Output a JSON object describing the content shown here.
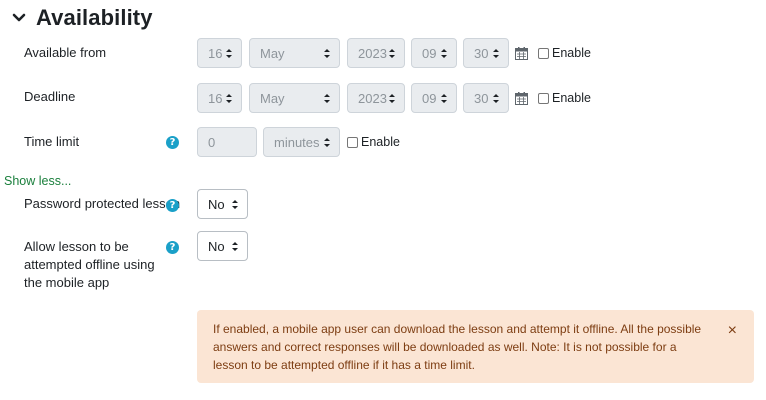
{
  "section": {
    "title": "Availability"
  },
  "available_from": {
    "label": "Available from",
    "day": "16",
    "month": "May",
    "year": "2023",
    "hour": "09",
    "minute": "30",
    "enable_label": "Enable"
  },
  "deadline": {
    "label": "Deadline",
    "day": "16",
    "month": "May",
    "year": "2023",
    "hour": "09",
    "minute": "30",
    "enable_label": "Enable"
  },
  "time_limit": {
    "label": "Time limit",
    "value": "0",
    "unit": "minutes",
    "enable_label": "Enable"
  },
  "show_less": "Show less...",
  "password_protected": {
    "label": "Password protected lesson",
    "value": "No"
  },
  "allow_offline": {
    "label": "Allow lesson to be attempted offline using the mobile app",
    "value": "No"
  },
  "alert": {
    "text": "If enabled, a mobile app user can download the lesson and attempt it offline. All the possible answers and correct responses will be downloaded as well. Note: It is not possible for a lesson to be attempted offline if it has a time limit.",
    "close": "×"
  },
  "icons": {
    "help": "?",
    "help_color": "#1aa0c8",
    "chevron": "chevron-down-icon",
    "calendar": "calendar-icon"
  }
}
